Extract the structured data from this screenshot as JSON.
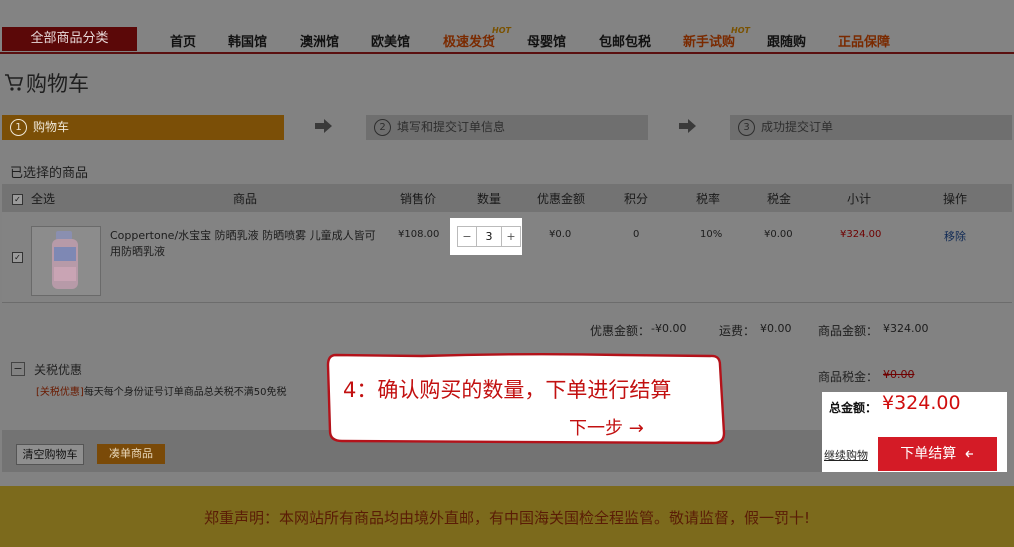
{
  "nav": {
    "all_categories": "全部商品分类",
    "items": [
      "首页",
      "韩国馆",
      "澳洲馆",
      "欧美馆",
      "极速发货",
      "母婴馆",
      "包邮包税",
      "新手试购",
      "跟随购",
      "正品保障"
    ],
    "hot_badge": "HOT"
  },
  "page": {
    "title": "购物车"
  },
  "steps": [
    {
      "num": "1",
      "label": "购物车"
    },
    {
      "num": "2",
      "label": "填写和提交订单信息"
    },
    {
      "num": "3",
      "label": "成功提交订单"
    }
  ],
  "cart": {
    "section_title": "已选择的商品",
    "headers": [
      "全选",
      "商品",
      "销售价",
      "数量",
      "优惠金额",
      "积分",
      "税率",
      "税金",
      "小计",
      "操作"
    ],
    "select_all_checked": true,
    "items": [
      {
        "checked": true,
        "name": "Coppertone/水宝宝 防晒乳液 防晒喷雾 儿童成人皆可用防晒乳液",
        "price": "¥108.00",
        "quantity": "3",
        "qty_minus": "−",
        "qty_plus": "+",
        "discount": "¥0.0",
        "points": "0",
        "tax_rate": "10%",
        "tax": "¥0.00",
        "subtotal": "¥324.00",
        "remove": "移除"
      }
    ]
  },
  "summary": {
    "discount_label": "优惠金额：",
    "discount_value": "-¥0.00",
    "shipping_label": "运费：",
    "shipping_value": "¥0.00",
    "goods_amount_label": "商品金额：",
    "goods_amount_value": "¥324.00",
    "goods_tax_label": "商品税金：",
    "goods_tax_value": "¥0.00",
    "total_label": "总金额：",
    "total_value": "¥324.00"
  },
  "tariff": {
    "collapse_symbol": "−",
    "title": "关税优惠",
    "note_tag": "[关税优惠]",
    "note_text": "每天每个身份证号订单商品总关税不满50免税"
  },
  "actions": {
    "clear_cart": "清空购物车",
    "merge_items": "凑单商品",
    "continue_shopping": "继续购物",
    "submit_order": "下单结算"
  },
  "callout": {
    "line1": "4：确认购买的数量，下单进行结算",
    "line2": "下一步 →"
  },
  "footer": {
    "notice": "郑重声明：本网站所有商品均由境外直邮，有中国海关国检全程监管。敬请监督，假一罚十!"
  },
  "colors": {
    "accent_red": "#d41b26",
    "total_red": "#cf0d0d",
    "callout_red": "#c21010"
  }
}
